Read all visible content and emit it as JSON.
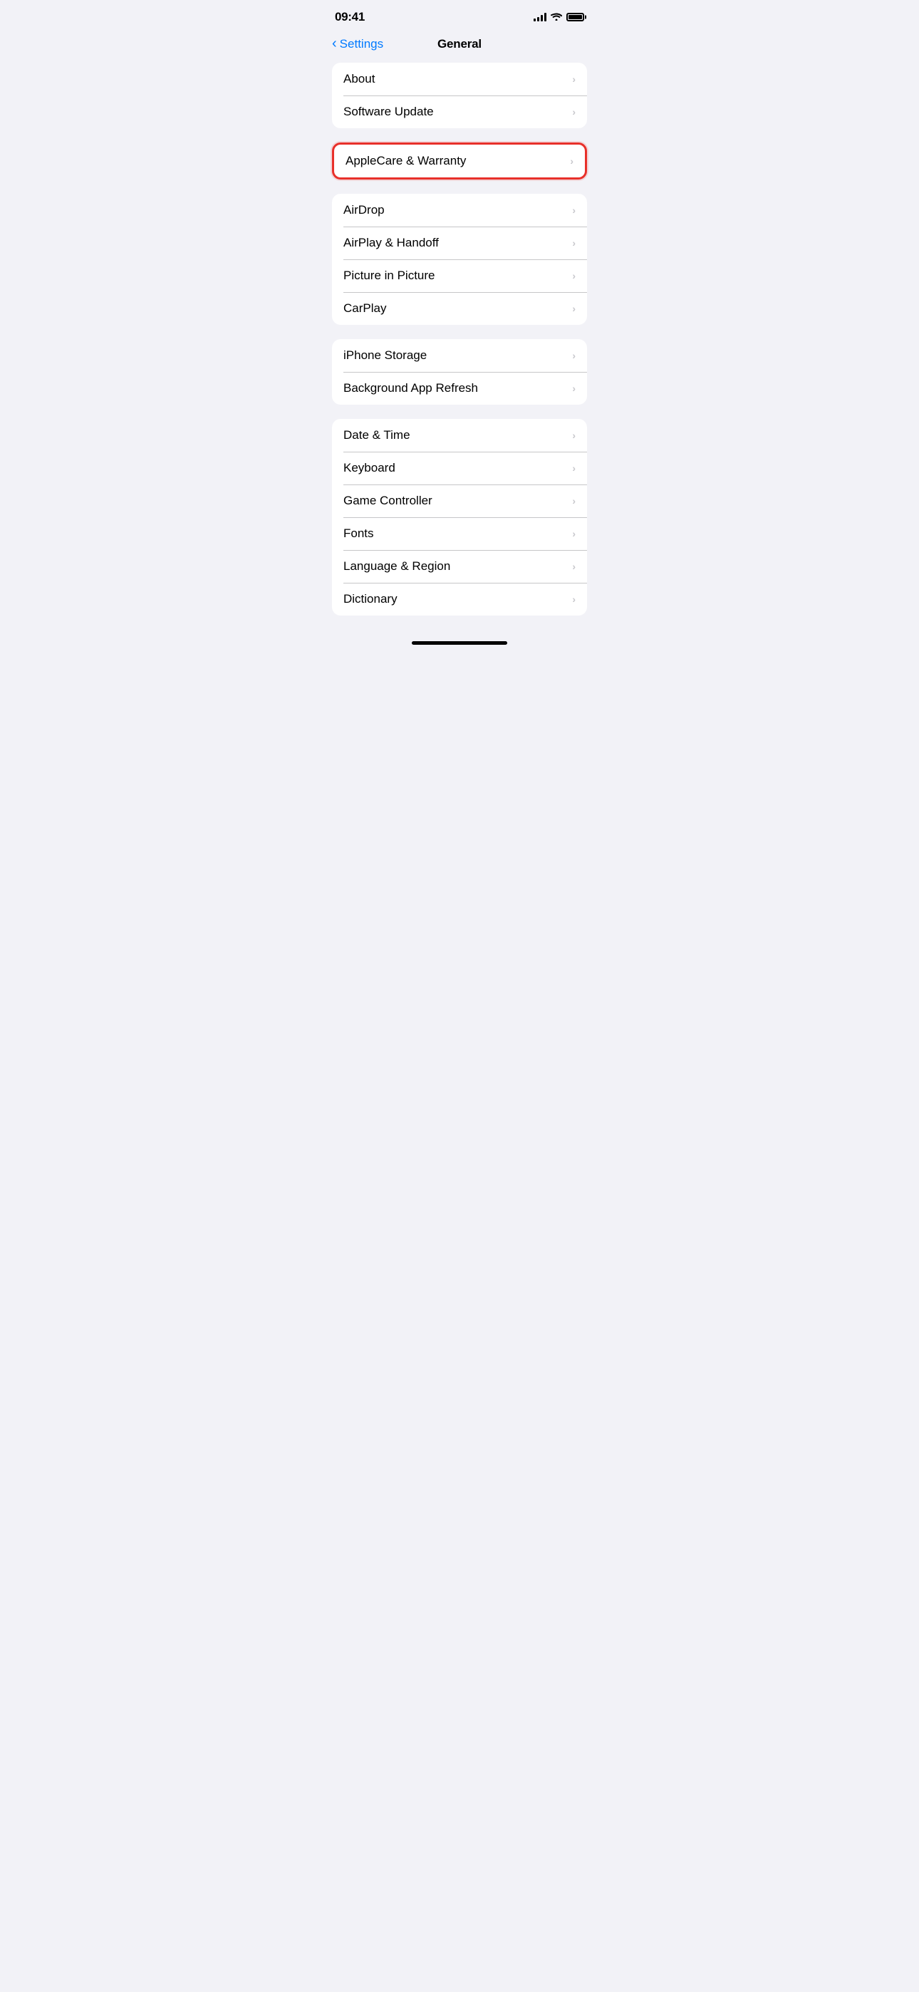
{
  "statusBar": {
    "time": "09:41",
    "signal": "full",
    "wifi": true,
    "battery": "full"
  },
  "navigation": {
    "backLabel": "Settings",
    "title": "General"
  },
  "groups": [
    {
      "id": "group-1",
      "highlighted": false,
      "items": [
        {
          "id": "about",
          "label": "About"
        },
        {
          "id": "software-update",
          "label": "Software Update"
        }
      ]
    },
    {
      "id": "group-2",
      "highlighted": true,
      "items": [
        {
          "id": "applecare-warranty",
          "label": "AppleCare & Warranty"
        }
      ]
    },
    {
      "id": "group-3",
      "highlighted": false,
      "items": [
        {
          "id": "airdrop",
          "label": "AirDrop"
        },
        {
          "id": "airplay-handoff",
          "label": "AirPlay & Handoff"
        },
        {
          "id": "picture-in-picture",
          "label": "Picture in Picture"
        },
        {
          "id": "carplay",
          "label": "CarPlay"
        }
      ]
    },
    {
      "id": "group-4",
      "highlighted": false,
      "items": [
        {
          "id": "iphone-storage",
          "label": "iPhone Storage"
        },
        {
          "id": "background-app-refresh",
          "label": "Background App Refresh"
        }
      ]
    },
    {
      "id": "group-5",
      "highlighted": false,
      "items": [
        {
          "id": "date-time",
          "label": "Date & Time"
        },
        {
          "id": "keyboard",
          "label": "Keyboard"
        },
        {
          "id": "game-controller",
          "label": "Game Controller"
        },
        {
          "id": "fonts",
          "label": "Fonts"
        },
        {
          "id": "language-region",
          "label": "Language & Region"
        },
        {
          "id": "dictionary",
          "label": "Dictionary"
        }
      ]
    }
  ]
}
